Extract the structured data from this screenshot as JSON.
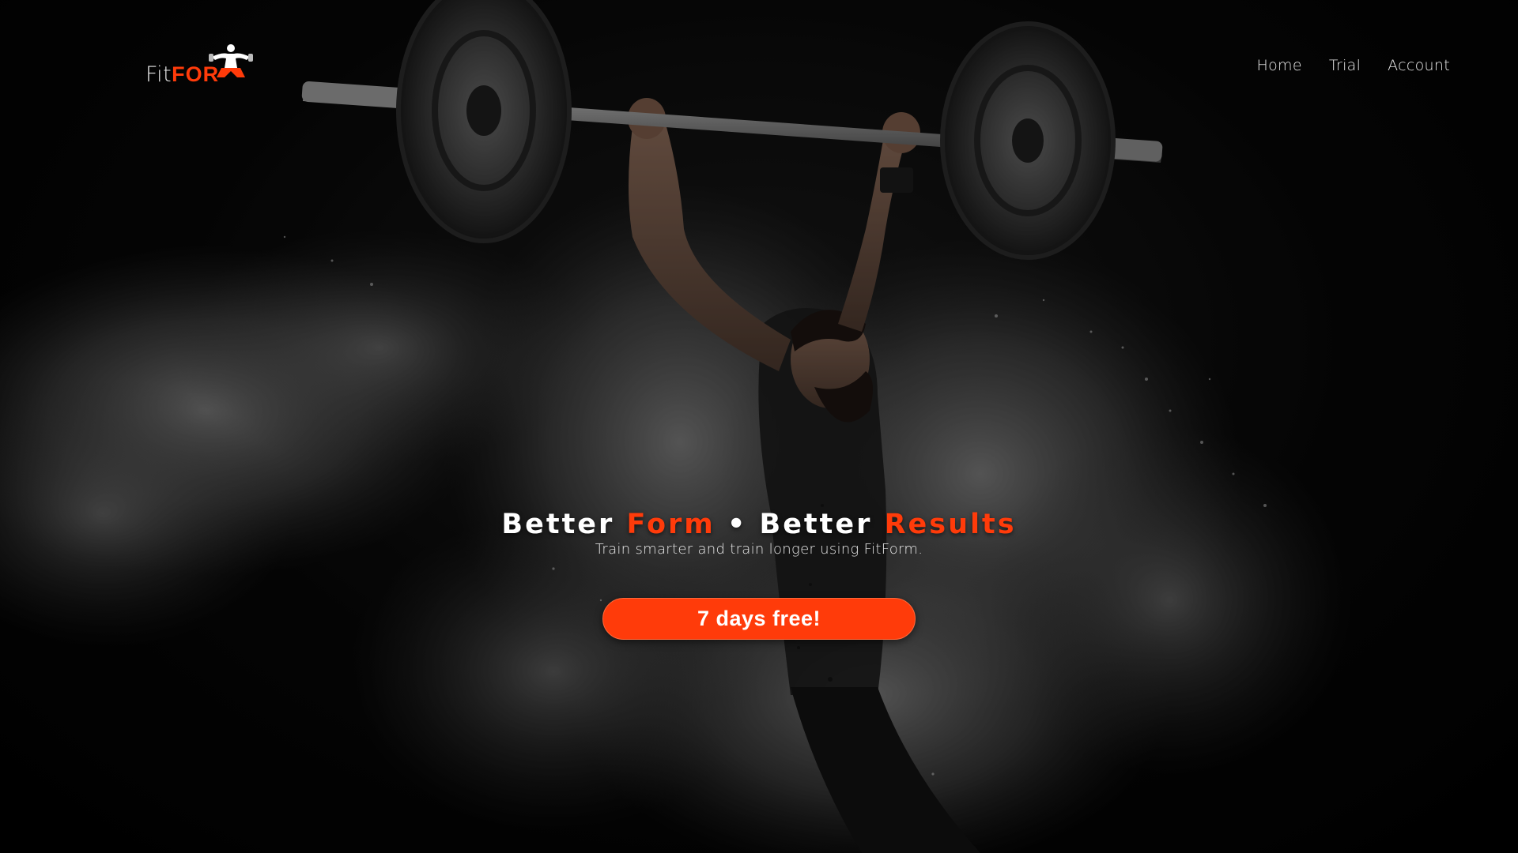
{
  "brand": {
    "logo_fit": "Fit",
    "logo_form": "FOR",
    "accent_color": "#ff3b0a"
  },
  "nav": {
    "items": [
      {
        "label": "Home"
      },
      {
        "label": "Trial"
      },
      {
        "label": "Account"
      }
    ]
  },
  "hero": {
    "headline_part1": "Better ",
    "headline_accent1": "Form",
    "headline_sep": " • ",
    "headline_part2": "Better ",
    "headline_accent2": "Results",
    "subtitle": "Train smarter and train longer using FitForm.",
    "cta_label": "7 days free!",
    "background_image": "weightlifter-icon"
  }
}
